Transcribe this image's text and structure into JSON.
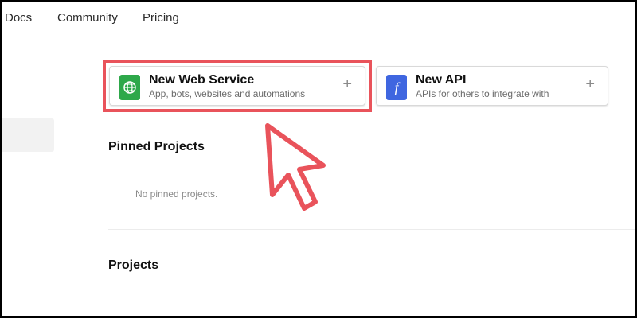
{
  "nav": {
    "items": [
      {
        "label": "Docs"
      },
      {
        "label": "Community"
      },
      {
        "label": "Pricing"
      }
    ]
  },
  "cards": {
    "web_service": {
      "title": "New Web Service",
      "description": "App, bots, websites and automations",
      "plus": "+",
      "icon": "globe-icon",
      "icon_color": "#2ea84a"
    },
    "api": {
      "title": "New API",
      "description": "APIs for others to integrate with",
      "plus": "+",
      "icon": "function-icon",
      "icon_color": "#3f66e0"
    }
  },
  "pinned": {
    "title": "Pinned Projects",
    "empty_text": "No pinned projects."
  },
  "projects": {
    "title": "Projects"
  },
  "annotation": {
    "highlight_color": "#e9535b"
  }
}
